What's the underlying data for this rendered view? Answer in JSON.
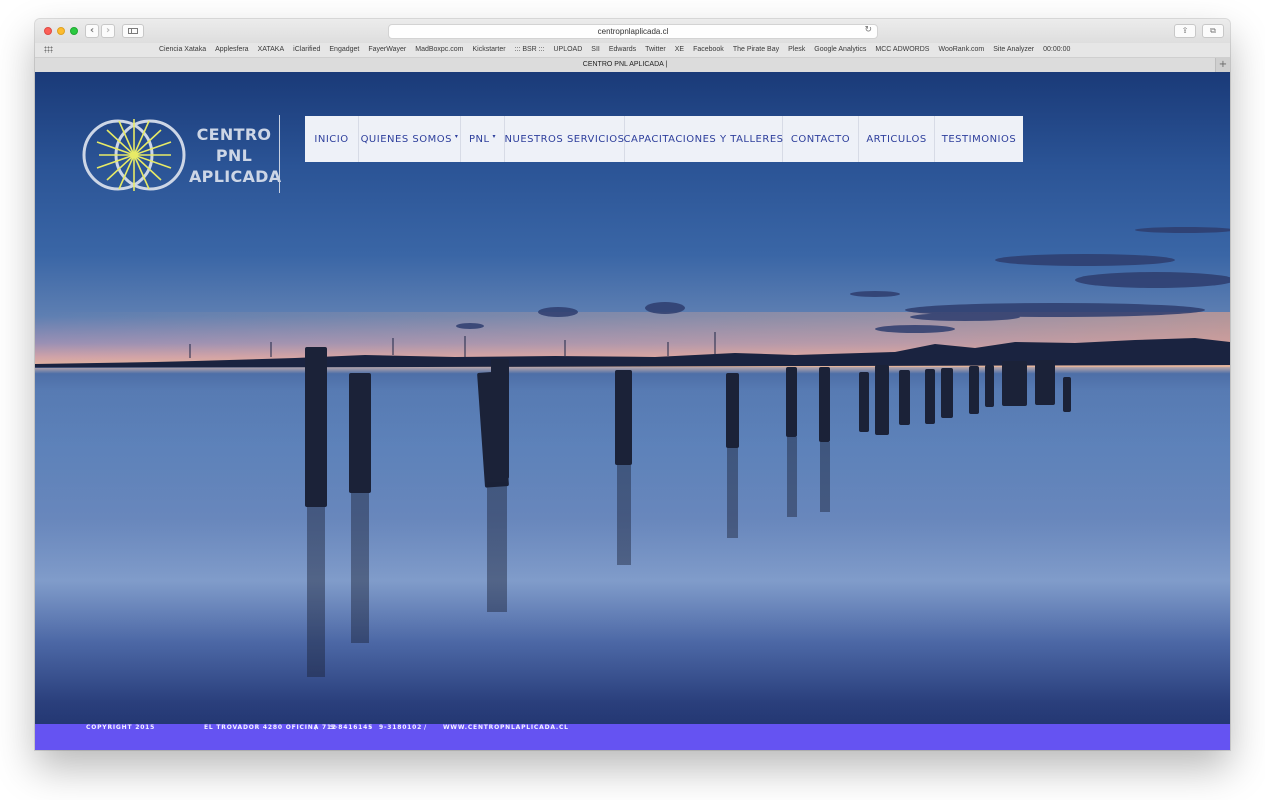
{
  "browser": {
    "url": "centropnlaplicada.cl",
    "tab_title": "CENTRO PNL APLICADA |",
    "bookmarks": [
      "Ciencia Xataka",
      "Applesfera",
      "XATAKA",
      "iClarified",
      "Engadget",
      "FayerWayer",
      "MadBoxpc.com",
      "Kickstarter",
      "::: BSR :::",
      "UPLOAD",
      "SII",
      "Edwards",
      "Twitter",
      "XE",
      "Facebook",
      "The Pirate Bay",
      "Plesk",
      "Google Analytics",
      "MCC ADWORDS",
      "WooRank.com",
      "Site Analyzer",
      "00:00:00"
    ]
  },
  "site": {
    "logo_text": [
      "CENTRO",
      "PNL",
      "APLICADA"
    ],
    "nav": [
      {
        "label": "INICIO",
        "has_dropdown": false
      },
      {
        "label": "QUIENES SOMOS",
        "has_dropdown": true
      },
      {
        "label": "PNL",
        "has_dropdown": true
      },
      {
        "label": "NUESTROS SERVICIOS",
        "has_dropdown": false
      },
      {
        "label": "CAPACITACIONES Y TALLERES",
        "has_dropdown": false
      },
      {
        "label": "CONTACTO",
        "has_dropdown": false
      },
      {
        "label": "ARTICULOS",
        "has_dropdown": false
      },
      {
        "label": "TESTIMONIOS",
        "has_dropdown": false
      }
    ],
    "footer": {
      "copyright": "COPYRIGHT 2015",
      "address": "EL TROVADOR 4280 OFICINA 712",
      "sep1": "/",
      "phone1": "9-8416145",
      "sep2": "-",
      "phone2": "9-3180102",
      "sep3": "/",
      "website": "WWW.CENTROPNLAPLICADA.CL"
    }
  },
  "colors": {
    "nav_text": "#2e3f9c",
    "footer_bg": "#6553f2",
    "logo_yellow": "#e7ea66",
    "logo_light": "#cdd6e6"
  },
  "icons": [
    "back-arrow-icon",
    "forward-arrow-icon",
    "sidebar-icon",
    "reload-icon",
    "share-icon",
    "tabs-overview-icon",
    "apps-grid-icon",
    "new-tab-plus-icon"
  ]
}
